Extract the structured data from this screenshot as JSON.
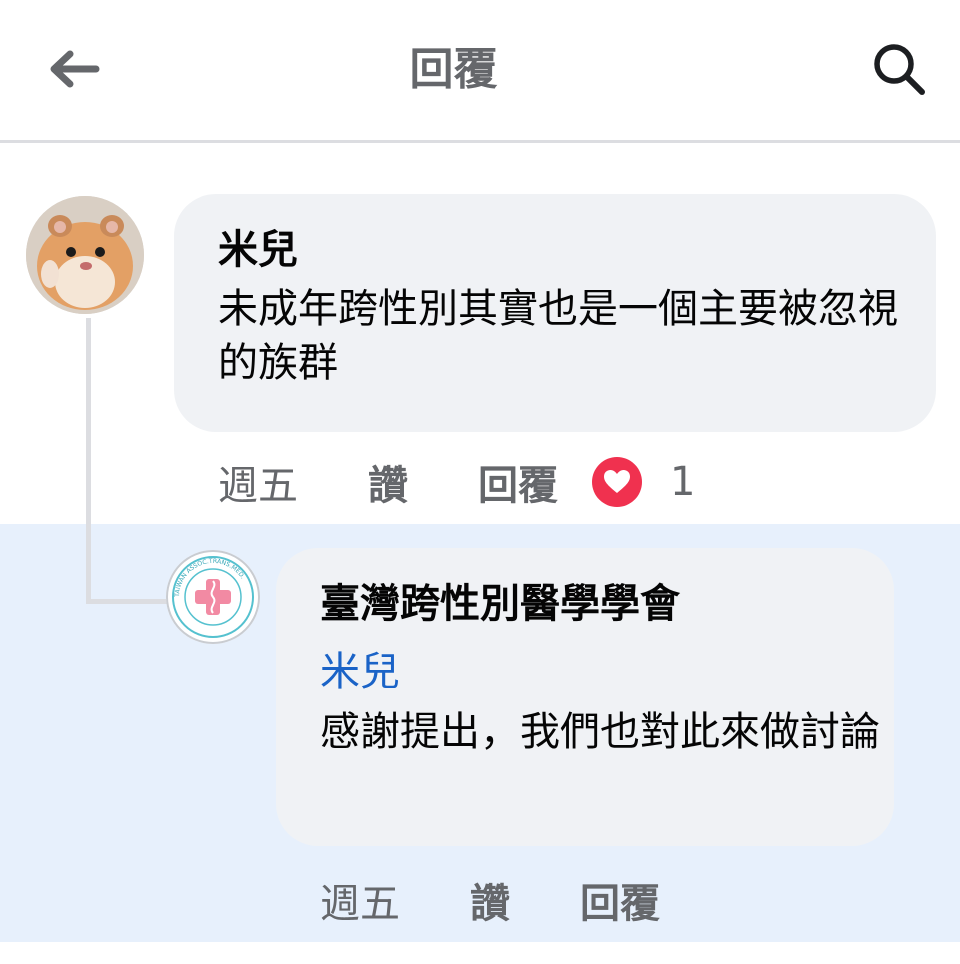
{
  "header": {
    "title": "回覆",
    "back_icon": "arrow-left-icon",
    "search_icon": "search-icon"
  },
  "comment": {
    "author": "米兒",
    "text": "未成年跨性別其實也是一個主要被忽視的族群",
    "time": "週五",
    "like_label": "讚",
    "reply_label": "回覆",
    "reaction_icon": "heart-icon",
    "reaction_count": "1"
  },
  "reply": {
    "author": "臺灣跨性別醫學學會",
    "logo_text": "TAIWAN ASSOC.TRANS.MED.",
    "mention": "米兒",
    "text": "感謝提出，我們也對此來做討論",
    "time": "週五",
    "like_label": "讚",
    "reply_label": "回覆"
  },
  "colors": {
    "accent": "#1a63c7",
    "reaction": "#f0314f",
    "reply_bg": "#e7f0fc",
    "bubble_bg": "#f0f2f5",
    "muted_text": "#65676b"
  }
}
